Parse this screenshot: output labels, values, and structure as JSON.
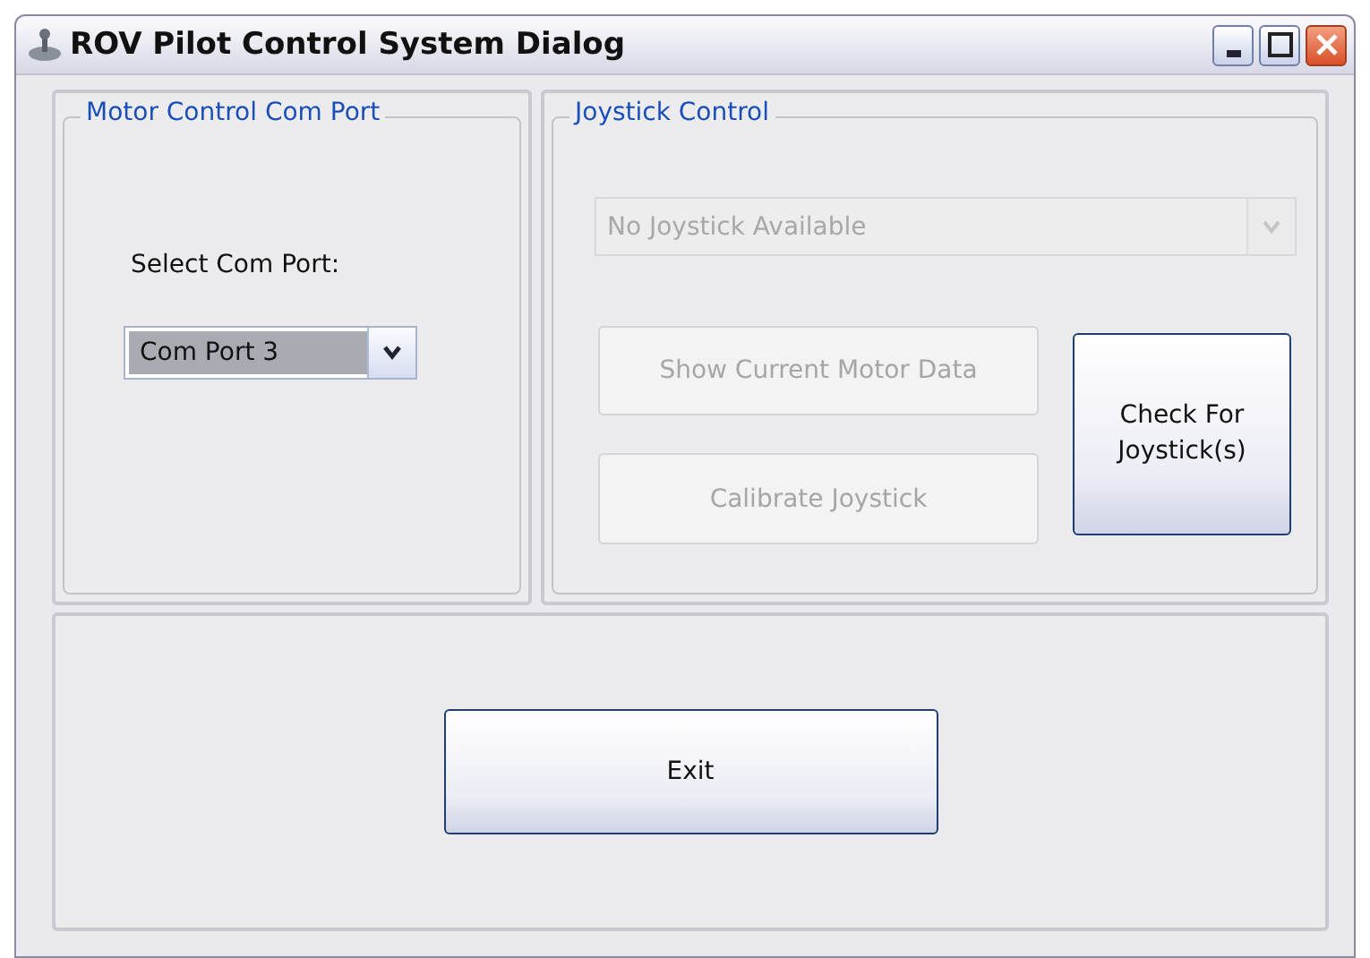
{
  "window": {
    "title": "ROV Pilot Control System Dialog"
  },
  "motor_group": {
    "title": "Motor Control Com Port",
    "label": "Select Com Port:",
    "combo": {
      "value": "Com Port 3",
      "disabled": false
    }
  },
  "joystick_group": {
    "title": "Joystick Control",
    "combo": {
      "value": "No Joystick Available",
      "disabled": true
    },
    "buttons": [
      {
        "label": "Show Current Motor Data",
        "disabled": true
      },
      {
        "label": "Calibrate Joystick",
        "disabled": true
      }
    ],
    "check_button": {
      "label": "Check For Joystick(s)",
      "disabled": false
    }
  },
  "exit_button": {
    "label": "Exit",
    "disabled": false
  }
}
